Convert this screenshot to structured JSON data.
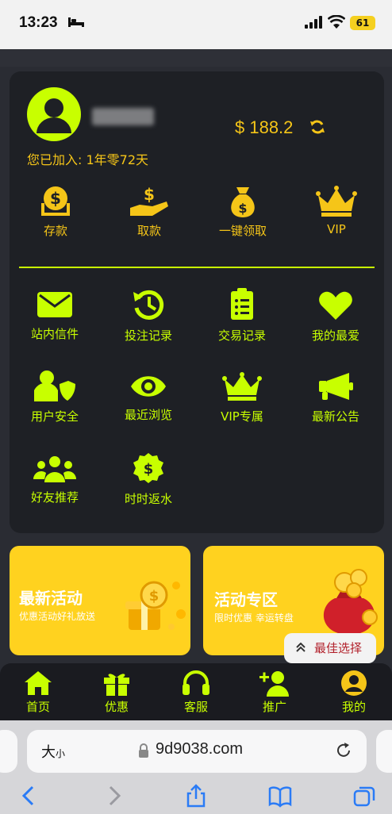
{
  "status_bar": {
    "time": "13:23",
    "battery": "61"
  },
  "profile": {
    "balance": "$ 188.2",
    "joined": "您已加入: 1年零72天"
  },
  "quick_actions": [
    {
      "label": "存款",
      "icon": "deposit-icon"
    },
    {
      "label": "取款",
      "icon": "withdraw-icon"
    },
    {
      "label": "一键领取",
      "icon": "money-bag-icon"
    },
    {
      "label": "VIP",
      "icon": "crown-icon"
    }
  ],
  "menu": [
    {
      "label": "站内信件",
      "icon": "envelope-icon"
    },
    {
      "label": "投注记录",
      "icon": "history-icon"
    },
    {
      "label": "交易记录",
      "icon": "clipboard-list-icon"
    },
    {
      "label": "我的最爱",
      "icon": "heart-icon"
    },
    {
      "label": "用户安全",
      "icon": "user-shield-icon"
    },
    {
      "label": "最近浏览",
      "icon": "eye-icon"
    },
    {
      "label": "VIP专属",
      "icon": "crown-icon"
    },
    {
      "label": "最新公告",
      "icon": "megaphone-icon"
    },
    {
      "label": "好友推荐",
      "icon": "users-icon"
    },
    {
      "label": "时时返水",
      "icon": "cashback-icon"
    }
  ],
  "promos": [
    {
      "title": "最新活动",
      "subtitle": "优惠活动好礼放送"
    },
    {
      "title": "活动专区",
      "subtitle": "限时优惠 幸运转盘"
    }
  ],
  "best_pick": "最佳选择",
  "tabs": [
    {
      "label": "首页",
      "icon": "home-icon"
    },
    {
      "label": "优惠",
      "icon": "gift-icon"
    },
    {
      "label": "客服",
      "icon": "headset-icon"
    },
    {
      "label": "推广",
      "icon": "user-plus-icon"
    },
    {
      "label": "我的",
      "icon": "account-icon"
    }
  ],
  "browser": {
    "text_size": "大",
    "text_size_small": "小",
    "url": "9d9038.com"
  },
  "colors": {
    "accent_lime": "#c8ff00",
    "accent_gold": "#f5c518",
    "panel": "#1e2025",
    "promo_yellow": "#ffd21f"
  }
}
